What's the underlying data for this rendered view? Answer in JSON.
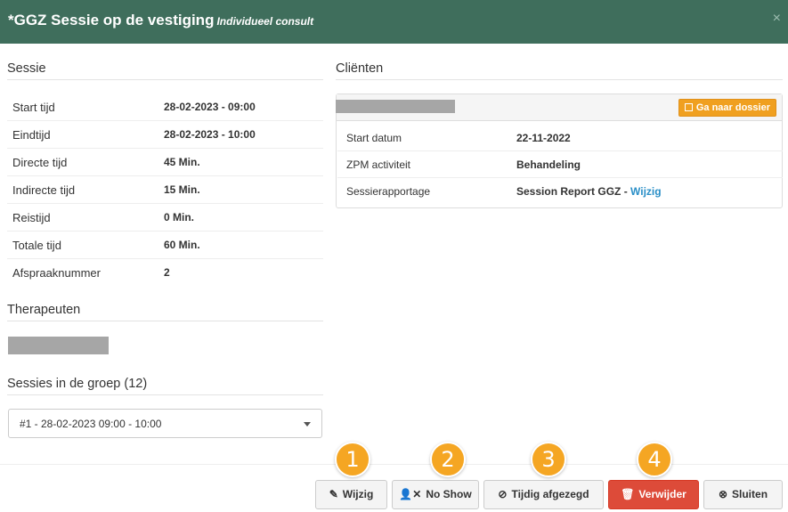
{
  "header": {
    "title": "*GGZ Sessie op de vestiging",
    "subtitle": "Individueel consult",
    "close_icon": "×"
  },
  "sessie": {
    "title": "Sessie",
    "rows": [
      {
        "label": "Start tijd",
        "value": "28-02-2023 - 09:00"
      },
      {
        "label": "Eindtijd",
        "value": "28-02-2023 - 10:00"
      },
      {
        "label": "Directe tijd",
        "value": "45 Min."
      },
      {
        "label": "Indirecte tijd",
        "value": "15 Min."
      },
      {
        "label": "Reistijd",
        "value": "0 Min."
      },
      {
        "label": "Totale tijd",
        "value": "60 Min."
      },
      {
        "label": "Afspraaknummer",
        "value": "2"
      }
    ]
  },
  "therapeuten": {
    "title": "Therapeuten"
  },
  "groep": {
    "title": "Sessies in de groep (12)",
    "selected": "#1 - 28-02-2023 09:00 - 10:00"
  },
  "clienten": {
    "title": "Cliënten",
    "dossier_button": "Ga naar dossier",
    "rows": [
      {
        "label": "Start datum",
        "value": "22-11-2022"
      },
      {
        "label": "ZPM activiteit",
        "value": "Behandeling"
      },
      {
        "label": "Sessierapportage",
        "value": "Session Report GGZ",
        "separator": " - ",
        "link": "Wijzig"
      }
    ]
  },
  "footer": {
    "buttons": {
      "wijzig": "Wijzig",
      "no_show": "No Show",
      "tijdig": "Tijdig afgezegd",
      "verwijder": "Verwijder",
      "sluiten": "Sluiten"
    },
    "badges": [
      "1",
      "2",
      "3",
      "4"
    ]
  },
  "colors": {
    "header": "#3f6e5c",
    "accent_orange": "#f0a020",
    "danger": "#dd4b39",
    "link": "#2a8fc7",
    "badge": "#f5a623"
  },
  "icons": {
    "close": "close-icon",
    "dossier": "external-link-icon",
    "wijzig": "pencil-icon",
    "no_show": "user-times-icon",
    "tijdig": "ban-icon",
    "verwijder": "trash-icon",
    "sluiten": "times-circle-icon"
  }
}
